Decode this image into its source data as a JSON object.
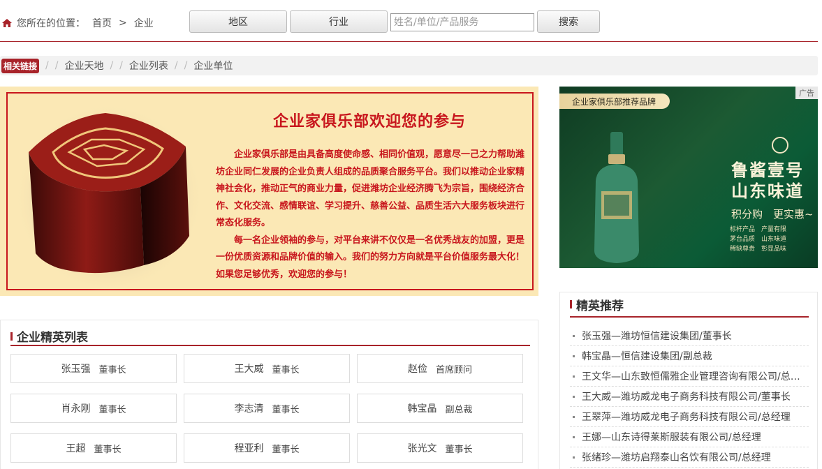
{
  "location": {
    "label": "您所在的位置：",
    "home": "首页",
    "separator": ">",
    "current": "企业"
  },
  "toolbar": {
    "region_label": "地区",
    "industry_label": "行业",
    "search_placeholder": "姓名/单位/产品服务",
    "search_button": "搜索"
  },
  "breadcrumb": {
    "tag": "相关链接",
    "items": [
      "企业天地",
      "企业列表",
      "企业单位"
    ]
  },
  "banner": {
    "title": "企业家俱乐部欢迎您的参与",
    "paragraphs": [
      "企业家俱乐部是由具备高度使命感、相同价值观，愿意尽一己之力帮助潍坊企业同仁发展的企业负责人组成的品质聚合服务平台。我们以推动企业家精神社会化，推动正气的商业力量，促进潍坊企业经济腾飞为宗旨，围绕经济合作、文化交流、感情联谊、学习提升、慈善公益、品质生活六大服务板块进行常态化服务。",
      "每一名企业领袖的参与，对平台来讲不仅仅是一名优秀战友的加盟，更是一份优质资源和品牌价值的输入。我们的努力方向就是平台价值服务最大化！如果您足够优秀，欢迎您的参与！"
    ]
  },
  "ad": {
    "tag": "广告",
    "ribbon": "企业家俱乐部推荐品牌",
    "brand_line1": "鲁酱壹号",
    "brand_line2": "山东味道",
    "slogan": "积分购　更实惠~",
    "features": [
      "标杆产品　产量有限",
      "茅台品质　山东味道",
      "稀缺尊贵　彰显品味"
    ]
  },
  "elite": {
    "title": "企业精英列表",
    "people": [
      {
        "name": "张玉强",
        "title": "董事长"
      },
      {
        "name": "王大威",
        "title": "董事长"
      },
      {
        "name": "赵俭",
        "title": "首席顾问"
      },
      {
        "name": "肖永刚",
        "title": "董事长"
      },
      {
        "name": "李志清",
        "title": "董事长"
      },
      {
        "name": "韩宝晶",
        "title": "副总裁"
      },
      {
        "name": "王超",
        "title": "董事长"
      },
      {
        "name": "程亚利",
        "title": "董事长"
      },
      {
        "name": "张光文",
        "title": "董事长"
      }
    ]
  },
  "recommend": {
    "title": "精英推荐",
    "items": [
      "张玉强—潍坊恒信建设集团/董事长",
      "韩宝晶—恒信建设集团/副总裁",
      "王文华—山东致恒儒雅企业管理咨询有限公司/总经理",
      "王大威—潍坊威龙电子商务科技有限公司/董事长",
      "王翠萍—潍坊威龙电子商务科技有限公司/总经理",
      "王娜—山东诗得莱斯服装有限公司/总经理",
      "张绪珍—潍坊启翔泰山名饮有限公司/总经理"
    ]
  },
  "colors": {
    "brand_red": "#a8232a",
    "banner_red": "#c8161d",
    "banner_bg": "#fbe8b5"
  }
}
